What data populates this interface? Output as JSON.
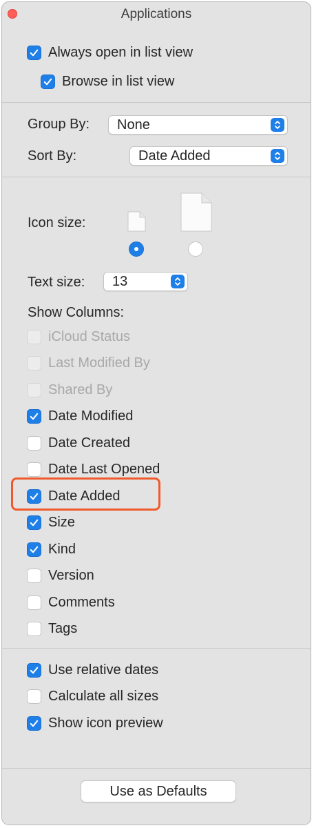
{
  "window": {
    "title": "Applications"
  },
  "top_options": [
    {
      "label": "Always open in list view",
      "checked": true
    },
    {
      "label": "Browse in list view",
      "checked": true
    }
  ],
  "group_by": {
    "label": "Group By:",
    "value": "None"
  },
  "sort_by": {
    "label": "Sort By:",
    "value": "Date Added"
  },
  "icon_size": {
    "label": "Icon size:",
    "selected": "small"
  },
  "text_size": {
    "label": "Text size:",
    "value": "13"
  },
  "show_columns": {
    "label": "Show Columns:",
    "items": [
      {
        "label": "iCloud Status",
        "checked": false,
        "disabled": true
      },
      {
        "label": "Last Modified By",
        "checked": false,
        "disabled": true
      },
      {
        "label": "Shared By",
        "checked": false,
        "disabled": true
      },
      {
        "label": "Date Modified",
        "checked": true,
        "disabled": false
      },
      {
        "label": "Date Created",
        "checked": false,
        "disabled": false
      },
      {
        "label": "Date Last Opened",
        "checked": false,
        "disabled": false
      },
      {
        "label": "Date Added",
        "checked": true,
        "disabled": false,
        "highlighted": true
      },
      {
        "label": "Size",
        "checked": true,
        "disabled": false
      },
      {
        "label": "Kind",
        "checked": true,
        "disabled": false
      },
      {
        "label": "Version",
        "checked": false,
        "disabled": false
      },
      {
        "label": "Comments",
        "checked": false,
        "disabled": false
      },
      {
        "label": "Tags",
        "checked": false,
        "disabled": false
      }
    ]
  },
  "bottom_options": [
    {
      "label": "Use relative dates",
      "checked": true
    },
    {
      "label": "Calculate all sizes",
      "checked": false
    },
    {
      "label": "Show icon preview",
      "checked": true
    }
  ],
  "defaults_button": {
    "label": "Use as Defaults"
  },
  "colors": {
    "accent": "#1f7fe8",
    "highlight": "#f05a2a",
    "close": "#ff5f57"
  }
}
